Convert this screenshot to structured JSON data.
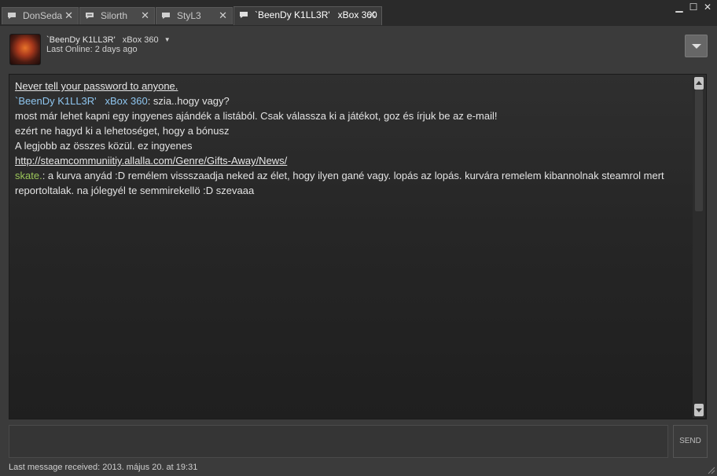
{
  "tabs": [
    {
      "label": "DonSeda",
      "close": "✕"
    },
    {
      "label": "Silorth",
      "close": "✕"
    },
    {
      "label": "StyL3",
      "close": "✕"
    },
    {
      "label": "`BeenDy K1LL3R'   xBox 360",
      "close": "✕"
    }
  ],
  "window_controls": {
    "minimize": "▁",
    "maximize": "☐",
    "close": "✕"
  },
  "header": {
    "name": "`BeenDy K1LL3R'",
    "game": "xBox 360",
    "caret": "▼",
    "last_online": "Last Online: 2 days ago"
  },
  "chat": {
    "warning": "Never tell your password to anyone.",
    "friend_name": "`BeenDy K1LL3R'   xBox 360",
    "msg1": ": szia..hogy vagy?",
    "line2": "most már lehet kapni egy ingyenes ajándék a listából. Csak válassza ki a játékot, goz és írjuk be az e-mail!",
    "line3": "ezért ne hagyd ki a lehetoséget, hogy a bónusz",
    "line4": "A legjobb az összes közül. ez ingyenes",
    "link": "http://steamcommuniitiy.allalla.com/Genre/Gifts-Away/News/",
    "self_name": "skate.",
    "self_msg": ": a kurva anyád :D remélem vissszaadja neked az élet, hogy ilyen gané vagy. lopás az lopás. kurvára remelem kibannolnak steamrol mert reportoltalak. na jólegyél te semmirekellö :D szevaaa"
  },
  "input": {
    "value": "",
    "send_label": "SEND"
  },
  "status": "Last message received: 2013. május 20. at 19:31",
  "colors": {
    "friend": "#8fc6f0",
    "self": "#9bc659",
    "background": "#3b3b3b"
  }
}
